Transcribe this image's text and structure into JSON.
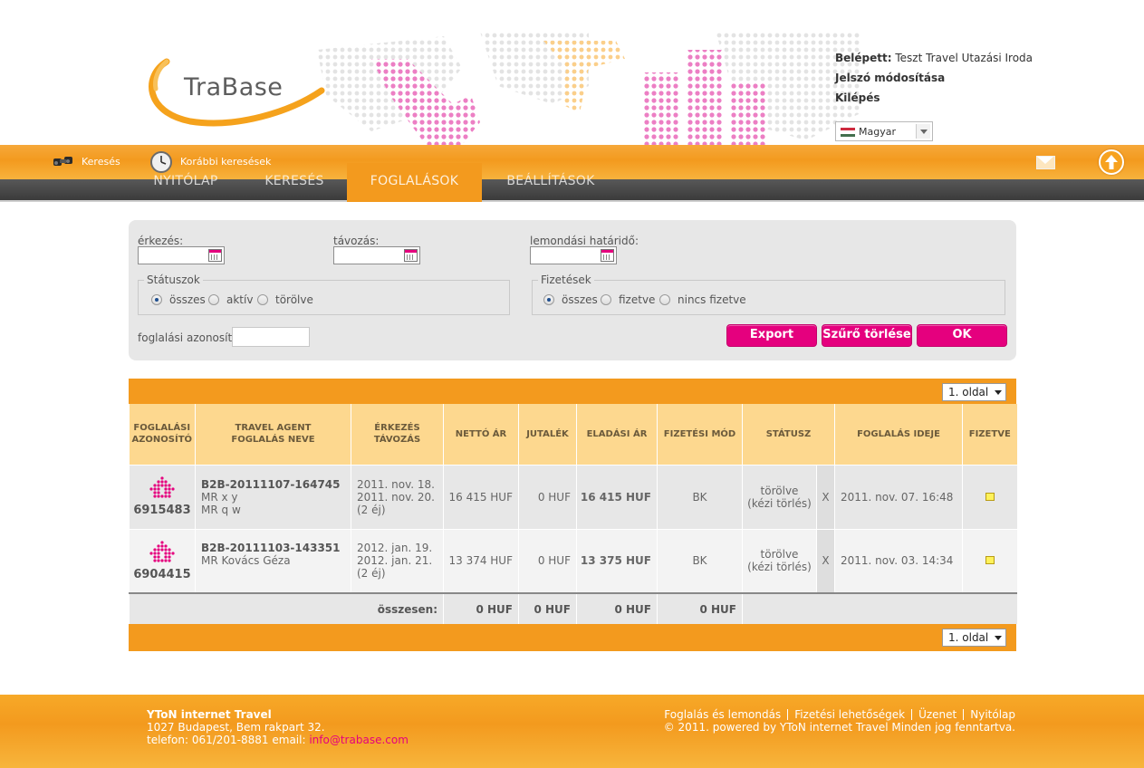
{
  "header": {
    "logo_text": "TraBase",
    "logged_in_label": "Belépett:",
    "logged_in_user": "Teszt Travel Utazási Iroda",
    "change_password": "Jelszó módosítása",
    "logout": "Kilépés",
    "language": "Magyar"
  },
  "toolbar": {
    "search_label": "Keresés",
    "previous_searches_label": "Korábbi keresések"
  },
  "nav": {
    "items": [
      "NYITÓLAP",
      "KERESÉS",
      "FOGLALÁSOK",
      "BEÁLLÍTÁSOK"
    ],
    "active": "FOGLALÁSOK"
  },
  "filter": {
    "arrival_label": "érkezés:",
    "departure_label": "távozás:",
    "cancel_deadline_label": "lemondási határidő:",
    "arrival_value": "",
    "departure_value": "",
    "cancel_deadline_value": "",
    "status_legend": "Státuszok",
    "status_options": [
      "összes",
      "aktív",
      "törölve"
    ],
    "status_selected": "összes",
    "payment_legend": "Fizetések",
    "payment_options": [
      "összes",
      "fizetve",
      "nincs fizetve"
    ],
    "payment_selected": "összes",
    "booking_id_label": "foglalási azonosító:",
    "booking_id_value": "",
    "export_button": "Export",
    "clear_filter_button": "Szűrő törlése",
    "ok_button": "OK"
  },
  "pager": {
    "top": "1. oldal",
    "bottom": "1. oldal"
  },
  "table": {
    "headers": {
      "id": [
        "FOGLALÁSI",
        "AZONOSÍTÓ"
      ],
      "agent": [
        "TRAVEL AGENT",
        "FOGLALÁS NEVE"
      ],
      "dates": [
        "ÉRKEZÉS",
        "TÁVOZÁS"
      ],
      "net": "NETTÓ ÁR",
      "commission": "JUTALÉK",
      "sale": "ELADÁSI ÁR",
      "payment_mode": "FIZETÉSI MÓD",
      "status": "STÁTUSZ",
      "booked_at": "FOGLALÁS IDEJE",
      "paid": "FIZETVE"
    },
    "rows": [
      {
        "id": "6915483",
        "code": "B2B-20111107-164745",
        "guests": [
          "MR x y",
          "MR q w"
        ],
        "arrival": "2011. nov. 18.",
        "departure": "2011. nov. 20.",
        "nights": "(2 éj)",
        "net": "16 415 HUF",
        "commission": "0 HUF",
        "sale": "16 415 HUF",
        "payment_mode": "BK",
        "status": [
          "törölve",
          "(kézi törlés)"
        ],
        "x": "X",
        "booked_at": "2011. nov. 07. 16:48",
        "paid": false
      },
      {
        "id": "6904415",
        "code": "B2B-20111103-143351",
        "guests": [
          "MR Kovács Géza"
        ],
        "arrival": "2012. jan. 19.",
        "departure": "2012. jan. 21.",
        "nights": "(2 éj)",
        "net": "13 374 HUF",
        "commission": "0 HUF",
        "sale": "13 375 HUF",
        "payment_mode": "BK",
        "status": [
          "törölve",
          "(kézi törlés)"
        ],
        "x": "X",
        "booked_at": "2011. nov. 03. 14:34",
        "paid": false
      }
    ],
    "total": {
      "label": "összesen:",
      "net": "0 HUF",
      "commission": "0 HUF",
      "sale": "0 HUF",
      "payment": "0 HUF"
    }
  },
  "footer": {
    "company": "YToN internet Travel",
    "address": "1027 Budapest, Bem rakpart 32.",
    "phone_email_prefix": "telefon: 061/201-8881 email:",
    "email": "info@trabase.com",
    "links": [
      "Foglalás és lemondás",
      "Fizetési lehetőségek",
      "Üzenet",
      "Nyitólap"
    ],
    "copyright": "© 2011. powered by YToN internet Travel Minden jog fenntartva."
  },
  "colors": {
    "orange": "#f39a1e",
    "magenta": "#e5007e",
    "header_cell": "#fdd88f"
  }
}
